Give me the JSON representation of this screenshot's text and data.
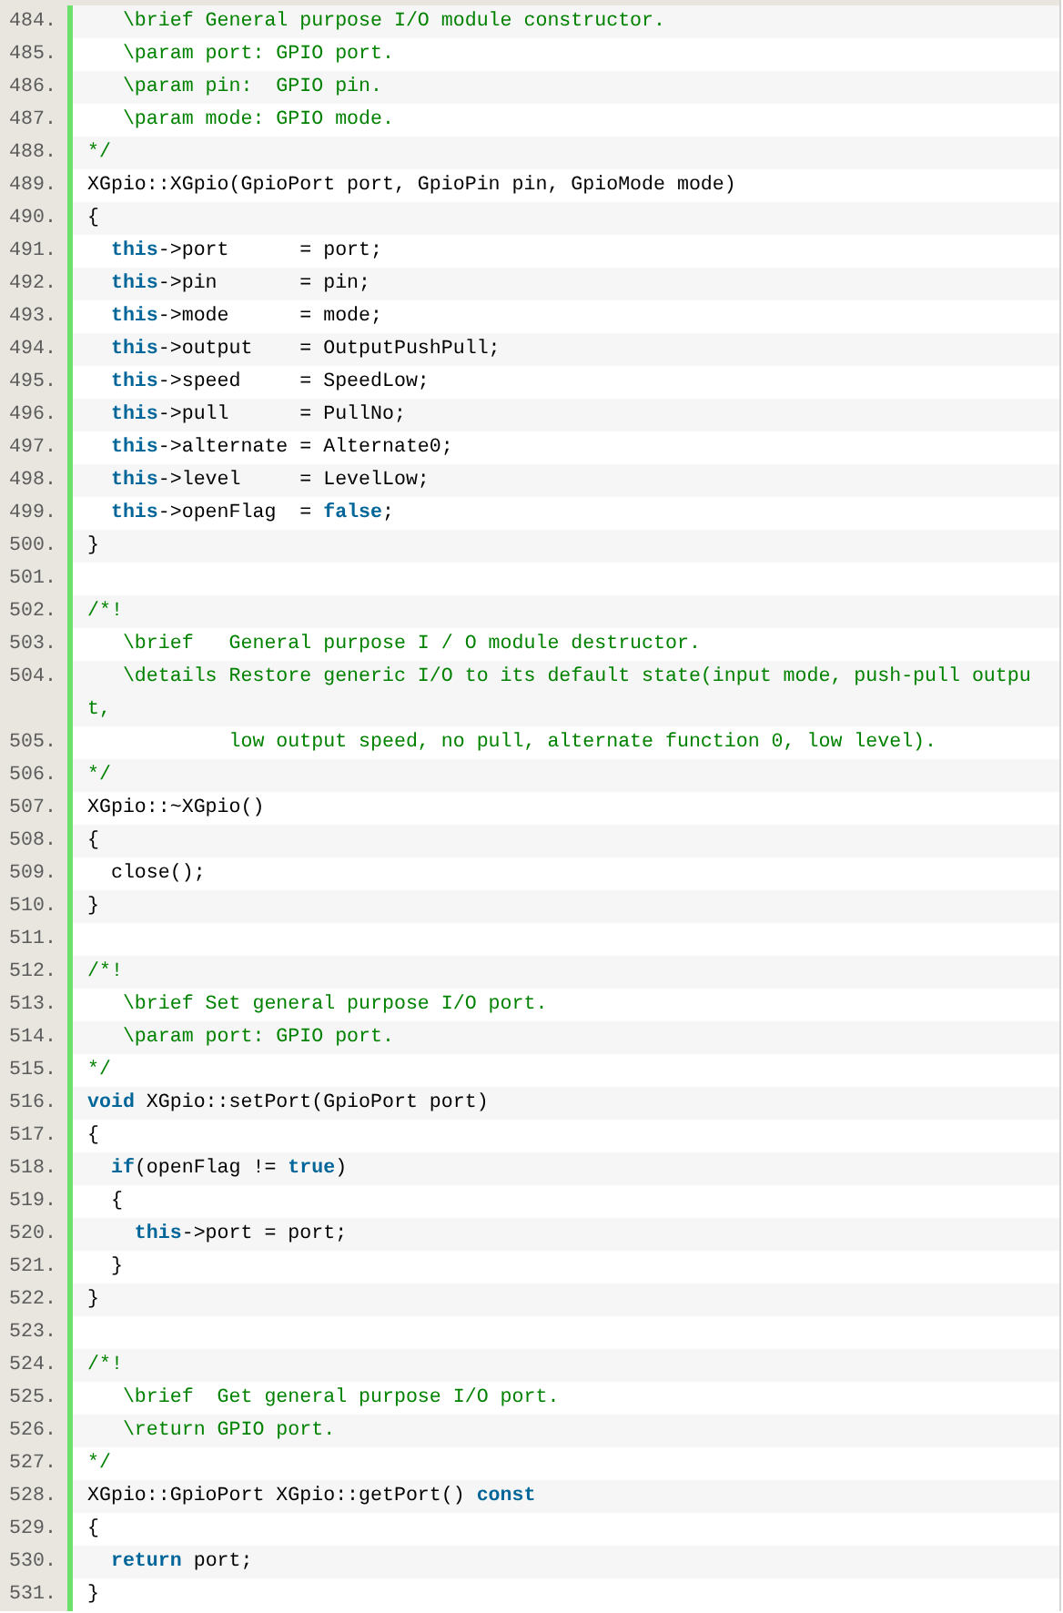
{
  "code_lines": [
    {
      "number": "484.",
      "tokens": [
        {
          "kind": "comment",
          "text": "   \\brief General purpose I/O module constructor."
        }
      ]
    },
    {
      "number": "485.",
      "tokens": [
        {
          "kind": "comment",
          "text": "   \\param port: GPIO port."
        }
      ]
    },
    {
      "number": "486.",
      "tokens": [
        {
          "kind": "comment",
          "text": "   \\param pin:  GPIO pin."
        }
      ]
    },
    {
      "number": "487.",
      "tokens": [
        {
          "kind": "comment",
          "text": "   \\param mode: GPIO mode."
        }
      ]
    },
    {
      "number": "488.",
      "tokens": [
        {
          "kind": "comment",
          "text": "*/"
        }
      ]
    },
    {
      "number": "489.",
      "tokens": [
        {
          "kind": "plain",
          "text": "XGpio::XGpio(GpioPort port, GpioPin pin, GpioMode mode)"
        }
      ]
    },
    {
      "number": "490.",
      "tokens": [
        {
          "kind": "plain",
          "text": "{"
        }
      ]
    },
    {
      "number": "491.",
      "tokens": [
        {
          "kind": "keyword",
          "text": "  this"
        },
        {
          "kind": "plain",
          "text": "->port      = port;"
        }
      ]
    },
    {
      "number": "492.",
      "tokens": [
        {
          "kind": "keyword",
          "text": "  this"
        },
        {
          "kind": "plain",
          "text": "->pin       = pin;"
        }
      ]
    },
    {
      "number": "493.",
      "tokens": [
        {
          "kind": "keyword",
          "text": "  this"
        },
        {
          "kind": "plain",
          "text": "->mode      = mode;"
        }
      ]
    },
    {
      "number": "494.",
      "tokens": [
        {
          "kind": "keyword",
          "text": "  this"
        },
        {
          "kind": "plain",
          "text": "->output    = OutputPushPull;"
        }
      ]
    },
    {
      "number": "495.",
      "tokens": [
        {
          "kind": "keyword",
          "text": "  this"
        },
        {
          "kind": "plain",
          "text": "->speed     = SpeedLow;"
        }
      ]
    },
    {
      "number": "496.",
      "tokens": [
        {
          "kind": "keyword",
          "text": "  this"
        },
        {
          "kind": "plain",
          "text": "->pull      = PullNo;"
        }
      ]
    },
    {
      "number": "497.",
      "tokens": [
        {
          "kind": "keyword",
          "text": "  this"
        },
        {
          "kind": "plain",
          "text": "->alternate = Alternate0;"
        }
      ]
    },
    {
      "number": "498.",
      "tokens": [
        {
          "kind": "keyword",
          "text": "  this"
        },
        {
          "kind": "plain",
          "text": "->level     = LevelLow;"
        }
      ]
    },
    {
      "number": "499.",
      "tokens": [
        {
          "kind": "keyword",
          "text": "  this"
        },
        {
          "kind": "plain",
          "text": "->openFlag  = "
        },
        {
          "kind": "keyword",
          "text": "false"
        },
        {
          "kind": "plain",
          "text": ";"
        }
      ]
    },
    {
      "number": "500.",
      "tokens": [
        {
          "kind": "plain",
          "text": "}"
        }
      ]
    },
    {
      "number": "501."
    },
    {
      "number": "502.",
      "tokens": [
        {
          "kind": "comment",
          "text": "/*!"
        }
      ]
    },
    {
      "number": "503.",
      "tokens": [
        {
          "kind": "comment",
          "text": "   \\brief   General purpose I / O module destructor."
        }
      ]
    },
    {
      "number": "504.",
      "tokens": [
        {
          "kind": "comment",
          "text": "   \\details Restore generic I/O to its default state(input mode, push-pull output,"
        }
      ]
    },
    {
      "number": "505.",
      "tokens": [
        {
          "kind": "comment",
          "text": "            low output speed, no pull, alternate function 0, low level)."
        }
      ]
    },
    {
      "number": "506.",
      "tokens": [
        {
          "kind": "comment",
          "text": "*/"
        }
      ]
    },
    {
      "number": "507.",
      "tokens": [
        {
          "kind": "plain",
          "text": "XGpio::~XGpio()"
        }
      ]
    },
    {
      "number": "508.",
      "tokens": [
        {
          "kind": "plain",
          "text": "{"
        }
      ]
    },
    {
      "number": "509.",
      "tokens": [
        {
          "kind": "plain",
          "text": "  close();"
        }
      ]
    },
    {
      "number": "510.",
      "tokens": [
        {
          "kind": "plain",
          "text": "}"
        }
      ]
    },
    {
      "number": "511."
    },
    {
      "number": "512.",
      "tokens": [
        {
          "kind": "comment",
          "text": "/*!"
        }
      ]
    },
    {
      "number": "513.",
      "tokens": [
        {
          "kind": "comment",
          "text": "   \\brief Set general purpose I/O port."
        }
      ]
    },
    {
      "number": "514.",
      "tokens": [
        {
          "kind": "comment",
          "text": "   \\param port: GPIO port."
        }
      ]
    },
    {
      "number": "515.",
      "tokens": [
        {
          "kind": "comment",
          "text": "*/"
        }
      ]
    },
    {
      "number": "516.",
      "tokens": [
        {
          "kind": "keyword",
          "text": "void"
        },
        {
          "kind": "plain",
          "text": " XGpio::setPort(GpioPort port)"
        }
      ]
    },
    {
      "number": "517.",
      "tokens": [
        {
          "kind": "plain",
          "text": "{"
        }
      ]
    },
    {
      "number": "518.",
      "tokens": [
        {
          "kind": "keyword",
          "text": "  if"
        },
        {
          "kind": "plain",
          "text": "(openFlag != "
        },
        {
          "kind": "keyword",
          "text": "true"
        },
        {
          "kind": "plain",
          "text": ")"
        }
      ]
    },
    {
      "number": "519.",
      "tokens": [
        {
          "kind": "plain",
          "text": "  {"
        }
      ]
    },
    {
      "number": "520.",
      "tokens": [
        {
          "kind": "keyword",
          "text": "    this"
        },
        {
          "kind": "plain",
          "text": "->port = port;"
        }
      ]
    },
    {
      "number": "521.",
      "tokens": [
        {
          "kind": "plain",
          "text": "  }"
        }
      ]
    },
    {
      "number": "522.",
      "tokens": [
        {
          "kind": "plain",
          "text": "}"
        }
      ]
    },
    {
      "number": "523."
    },
    {
      "number": "524.",
      "tokens": [
        {
          "kind": "comment",
          "text": "/*!"
        }
      ]
    },
    {
      "number": "525.",
      "tokens": [
        {
          "kind": "comment",
          "text": "   \\brief  Get general purpose I/O port."
        }
      ]
    },
    {
      "number": "526.",
      "tokens": [
        {
          "kind": "comment",
          "text": "   \\return GPIO port."
        }
      ]
    },
    {
      "number": "527.",
      "tokens": [
        {
          "kind": "comment",
          "text": "*/"
        }
      ]
    },
    {
      "number": "528.",
      "tokens": [
        {
          "kind": "plain",
          "text": "XGpio::GpioPort XGpio::getPort() "
        },
        {
          "kind": "keyword",
          "text": "const"
        }
      ]
    },
    {
      "number": "529.",
      "tokens": [
        {
          "kind": "plain",
          "text": "{"
        }
      ]
    },
    {
      "number": "530.",
      "tokens": [
        {
          "kind": "keyword",
          "text": "  return"
        },
        {
          "kind": "plain",
          "text": " port;"
        }
      ]
    },
    {
      "number": "531.",
      "tokens": [
        {
          "kind": "plain",
          "text": "}"
        }
      ]
    }
  ]
}
